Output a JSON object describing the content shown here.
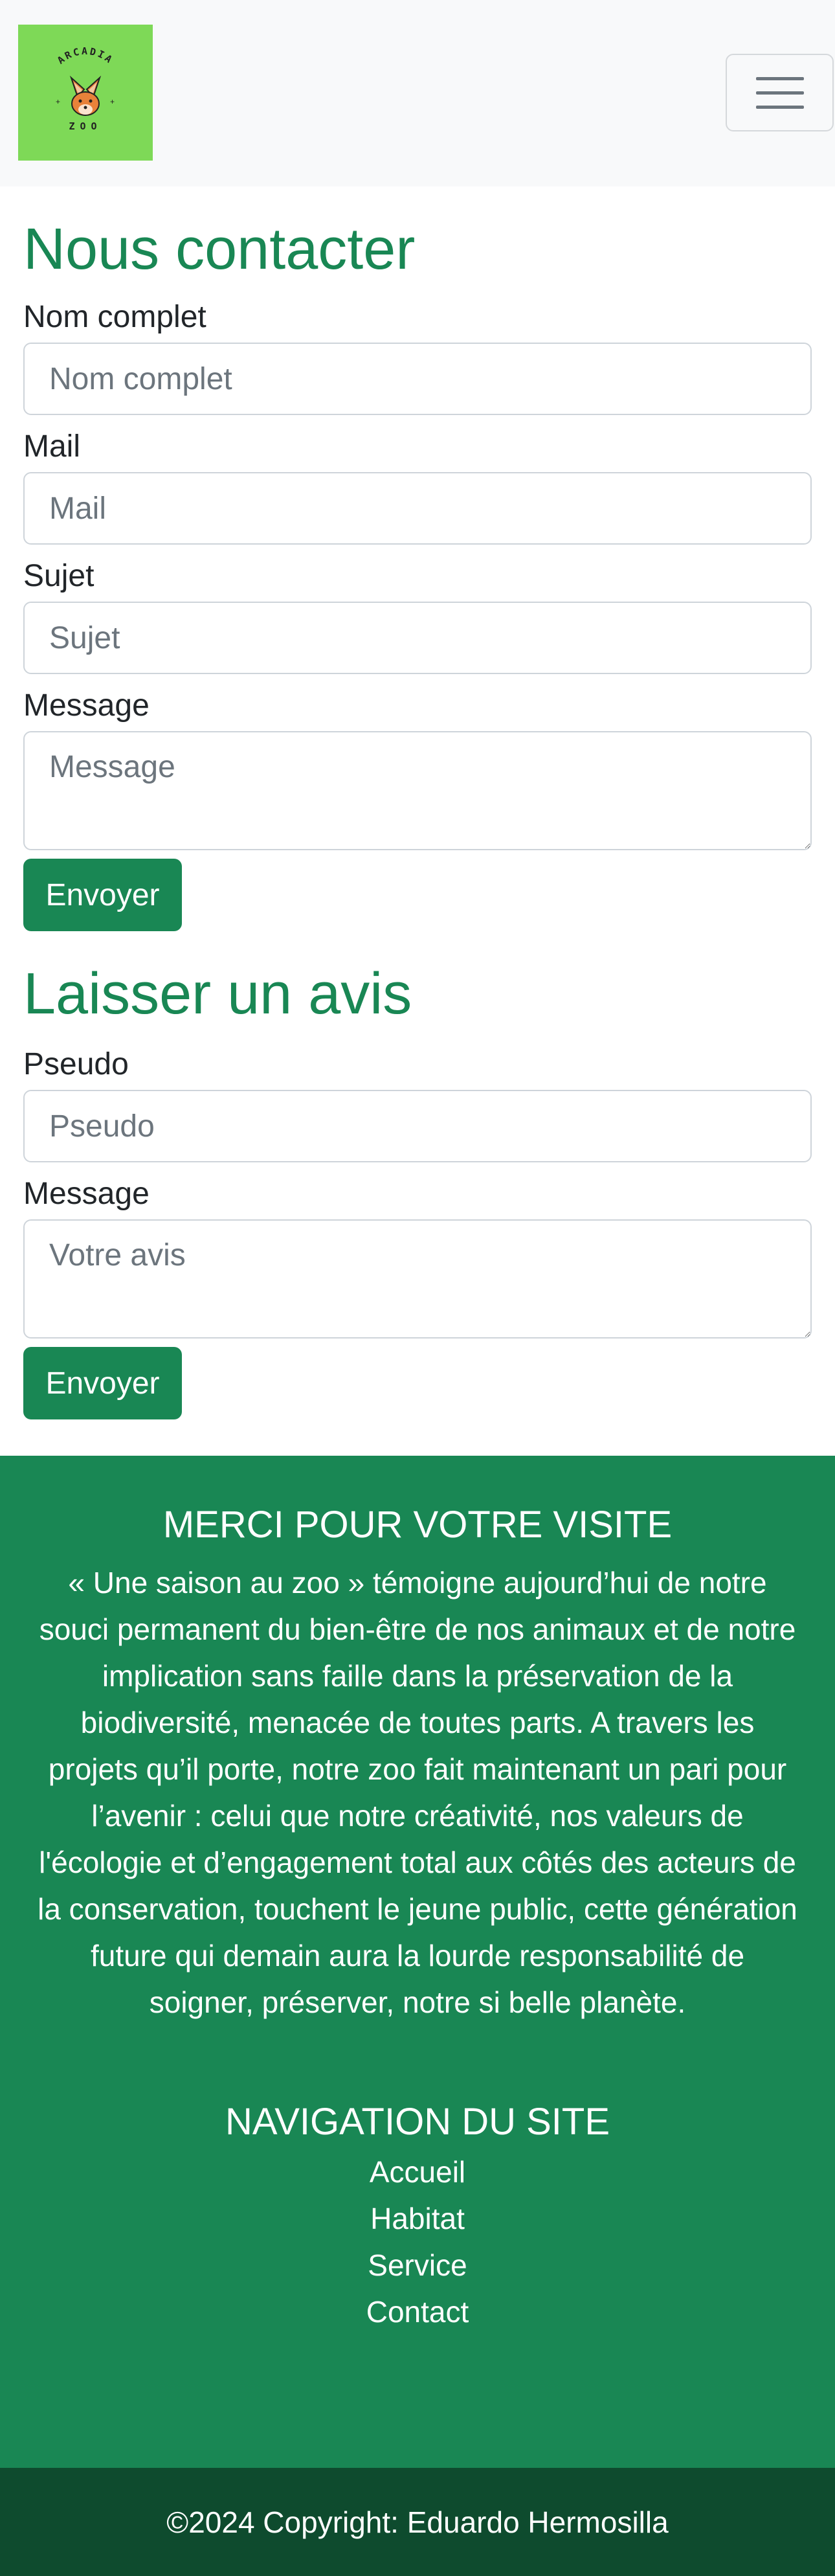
{
  "header": {
    "logo": {
      "top_text": "ARCADIA",
      "bottom_text": "ZOO",
      "background_color": "#7ed957"
    },
    "menu_icon": "hamburger-icon"
  },
  "contact": {
    "title": "Nous contacter",
    "name": {
      "label": "Nom complet",
      "placeholder": "Nom complet",
      "value": ""
    },
    "email": {
      "label": "Mail",
      "placeholder": "Mail",
      "value": ""
    },
    "subject": {
      "label": "Sujet",
      "placeholder": "Sujet",
      "value": ""
    },
    "message": {
      "label": "Message",
      "placeholder": "Message",
      "value": ""
    },
    "submit_label": "Envoyer"
  },
  "review": {
    "title": "Laisser un avis",
    "pseudo": {
      "label": "Pseudo",
      "placeholder": "Pseudo",
      "value": ""
    },
    "message": {
      "label": "Message",
      "placeholder": "Votre avis",
      "value": ""
    },
    "submit_label": "Envoyer"
  },
  "footer": {
    "thanks_title": "MERCI POUR VOTRE VISITE",
    "thanks_text": "« Une saison au zoo » témoigne aujourd’hui de notre souci permanent du bien-être de nos animaux et de notre implication sans faille dans la préservation de la biodiversité, menacée de toutes parts. A travers les projets qu’il porte, notre zoo fait maintenant un pari pour l’avenir : celui que notre créativité, nos valeurs de l'écologie et d’engagement total aux côtés des acteurs de la conservation, touchent le jeune public, cette génération future qui demain aura la lourde responsabilité de soigner, préserver, notre si belle planète.",
    "nav_title": "NAVIGATION DU SITE",
    "nav_links": [
      "Accueil",
      "Habitat",
      "Service",
      "Contact"
    ],
    "copyright": "©2024 Copyright: Eduardo Hermosilla"
  },
  "colors": {
    "primary": "#198754",
    "footer_bottom": "#0e4b2e",
    "navbar_bg": "#f8f9fa"
  }
}
